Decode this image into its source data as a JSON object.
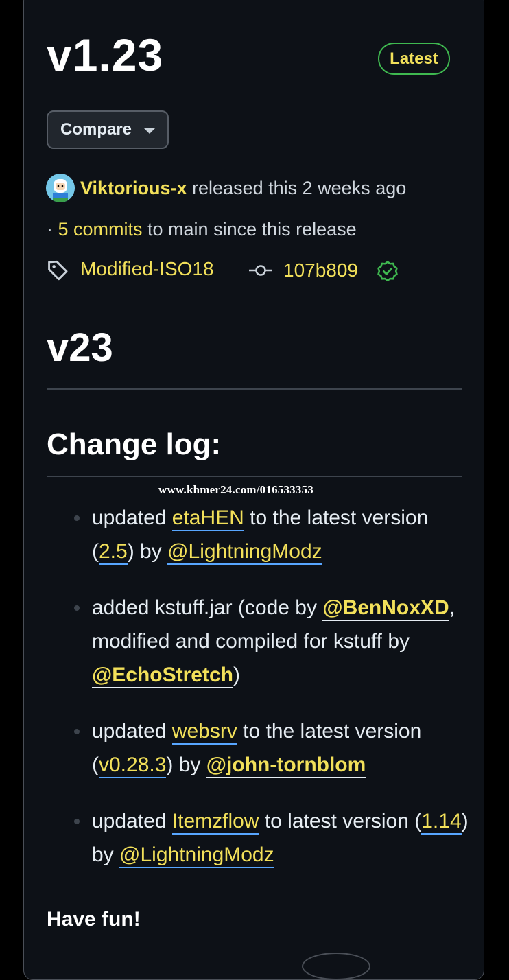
{
  "release": {
    "title": "v1.23",
    "badge": "Latest",
    "compare_label": "Compare",
    "author": "Viktorious-x",
    "released_text": " released this 2 weeks ago",
    "commits_prefix": "· ",
    "commits_link": "5 commits",
    "commits_suffix": " to main since this release",
    "tag": "Modified-ISO18",
    "commit_sha": "107b809"
  },
  "body": {
    "heading": "v23",
    "changelog_heading": "Change log:",
    "watermark": "www.khmer24.com/016533353",
    "items": [
      {
        "t1": "updated ",
        "l1": "etaHEN",
        "t2": " to the latest version (",
        "l2": "2.5",
        "t3": ") by ",
        "l3": "@LightningModz",
        "t4": ""
      },
      {
        "t1": "added kstuff.jar (code by ",
        "l1": "@BenNoxXD",
        "t2": ", modified and compiled for kstuff by ",
        "l2": "@EchoStretch",
        "t3": ")"
      },
      {
        "t1": "updated ",
        "l1": "websrv",
        "t2": " to the latest version (",
        "l2": "v0.28.3",
        "t3": ") by ",
        "l3": "@john-tornblom",
        "t4": ""
      },
      {
        "t1": "updated ",
        "l1": "Itemzflow",
        "t2": " to latest version (",
        "l2": "1.14",
        "t3": ") by ",
        "l3": "@LightningModz",
        "t4": ""
      }
    ],
    "closing": "Have fun!"
  },
  "colors": {
    "background": "#0d1117",
    "link": "#f2e05a",
    "badge_border": "#3fb950",
    "link_underline": "#58a6ff"
  },
  "icons": [
    "tag-icon",
    "git-commit-icon",
    "verified-icon",
    "chevron-down-icon",
    "avatar"
  ]
}
